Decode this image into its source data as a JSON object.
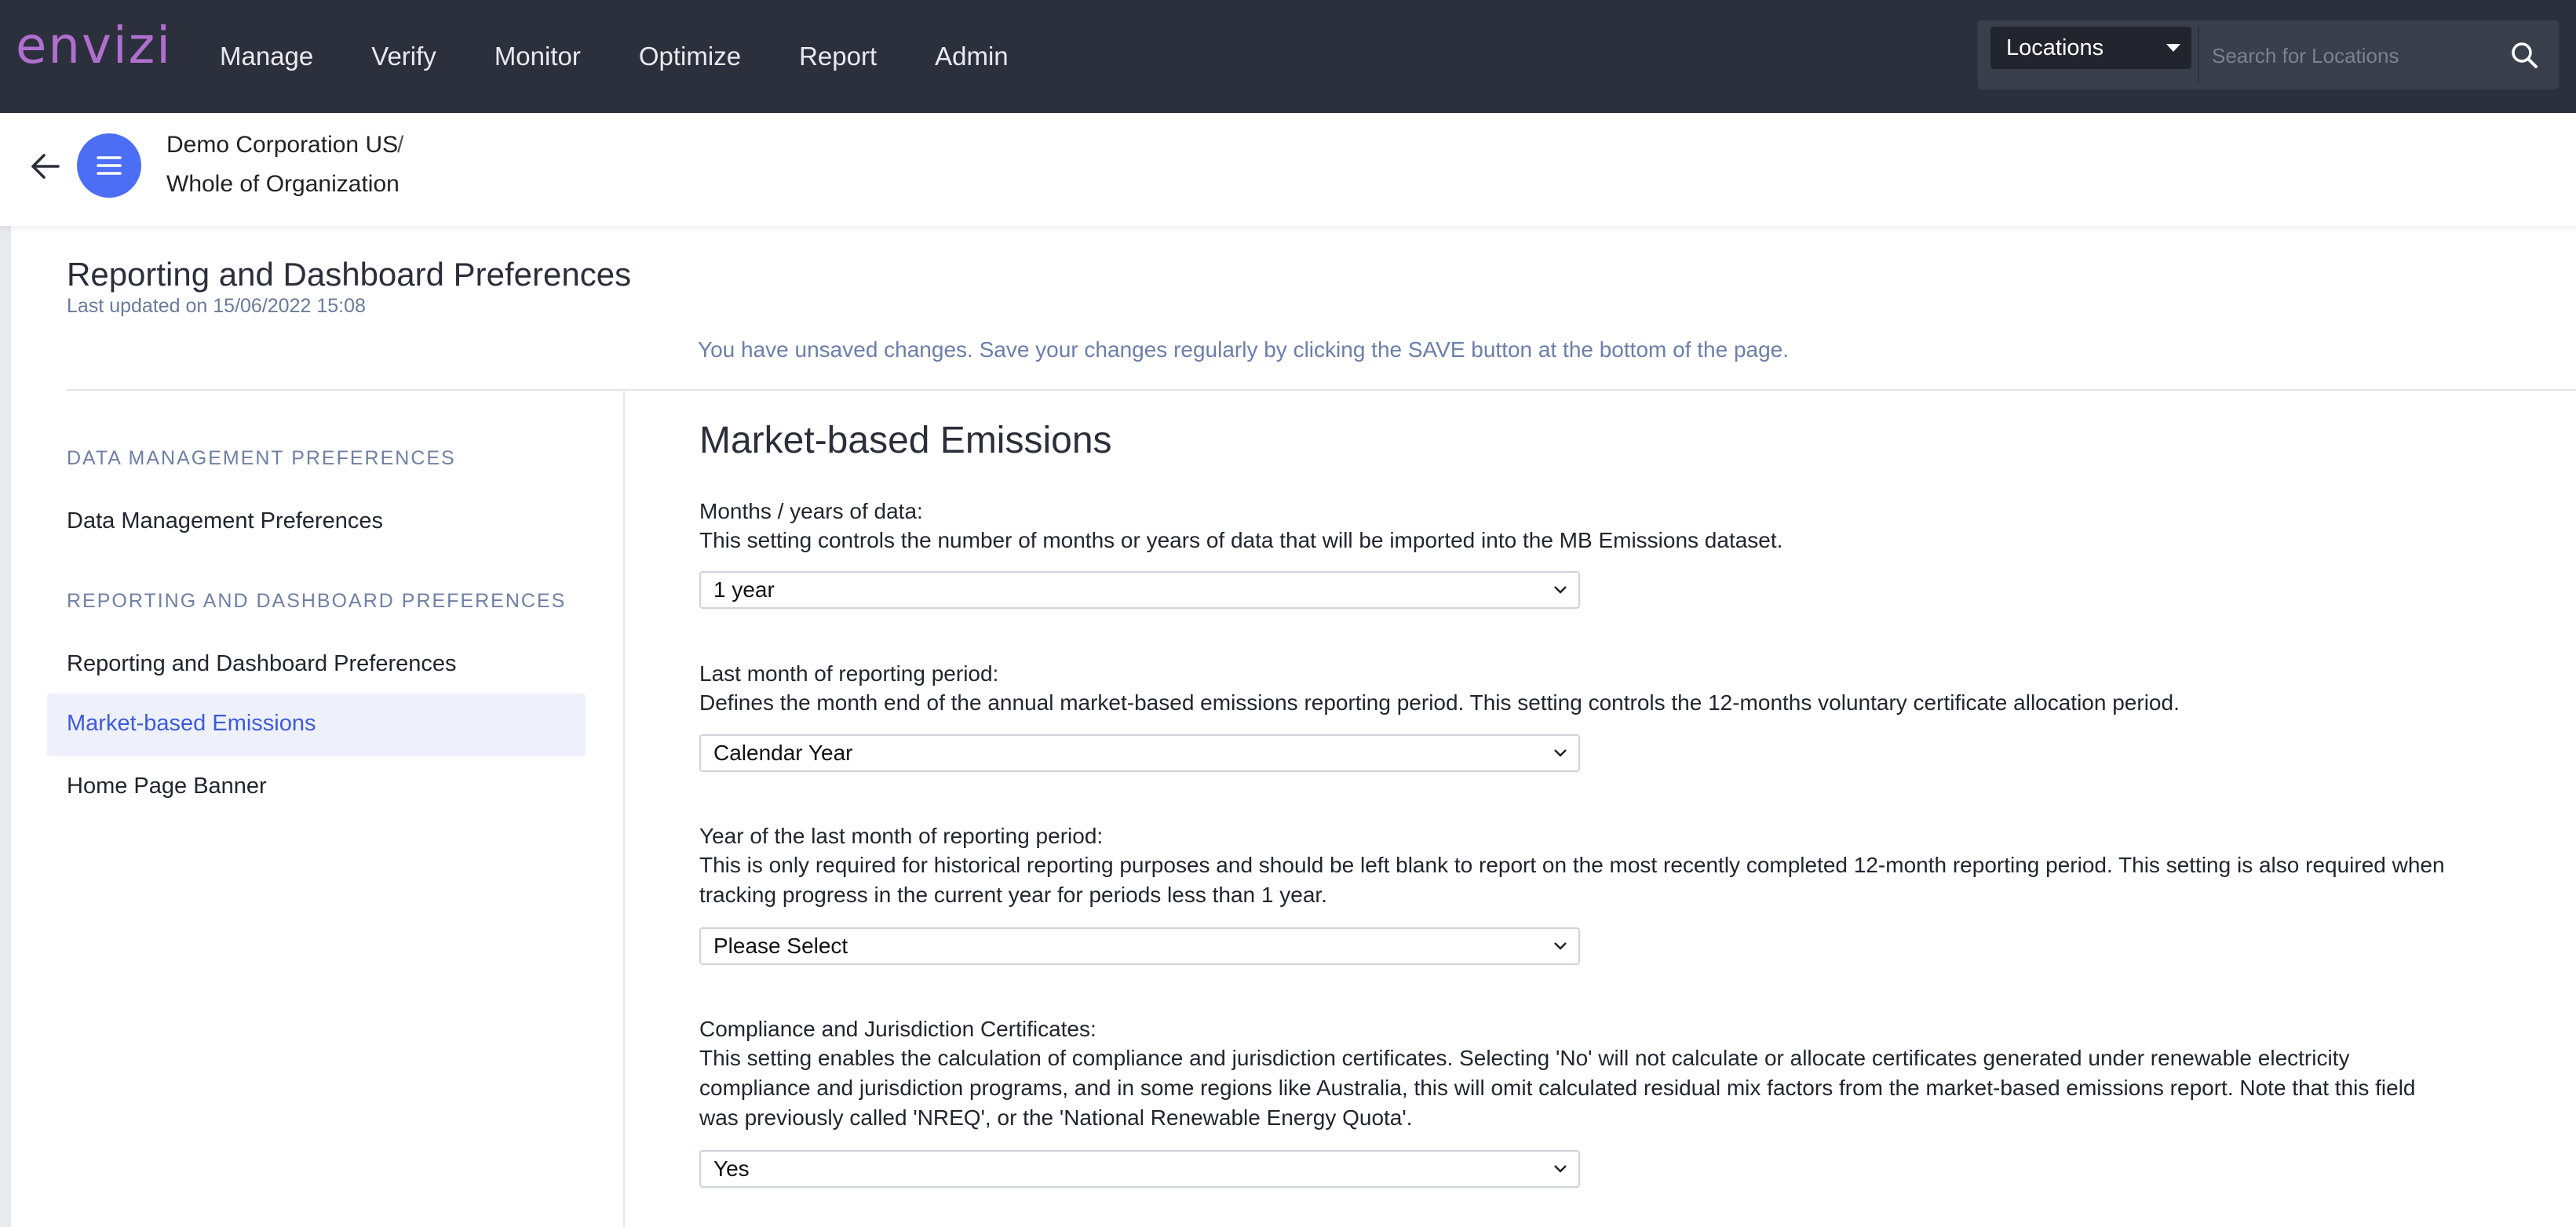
{
  "brand": {
    "logo_text": "envizi",
    "accent": "#b06fcf"
  },
  "nav": {
    "items": [
      "Manage",
      "Verify",
      "Monitor",
      "Optimize",
      "Report",
      "Admin"
    ]
  },
  "search": {
    "scope_label": "Locations",
    "placeholder": "Search for Locations"
  },
  "breadcrumb": {
    "parent": "Demo Corporation US",
    "separator": "/",
    "current": "Whole of Organization"
  },
  "page": {
    "title": "Reporting and Dashboard Preferences",
    "last_updated": "Last updated on 15/06/2022 15:08",
    "unsaved_notice": "You have unsaved changes. Save your changes regularly by clicking the SAVE button at the bottom of the page."
  },
  "sidebar": {
    "section1_heading": "DATA MANAGEMENT PREFERENCES",
    "section1_items": [
      "Data Management Preferences"
    ],
    "section2_heading": "REPORTING AND DASHBOARD PREFERENCES",
    "section2_items": [
      "Reporting and Dashboard Preferences",
      "Market-based Emissions",
      "Home Page Banner"
    ],
    "active_item": "Market-based Emissions"
  },
  "main": {
    "title": "Market-based Emissions",
    "fields": [
      {
        "label": "Months / years of data:",
        "description": "This setting controls the number of months or years of data that will be imported into the MB Emissions dataset.",
        "value": "1 year"
      },
      {
        "label": "Last month of reporting period:",
        "description": "Defines the month end of the annual market-based emissions reporting period. This setting controls the 12-months voluntary certificate allocation period.",
        "value": "Calendar Year"
      },
      {
        "label": "Year of the last month of reporting period:",
        "description": "This is only required for historical reporting purposes and should be left blank to report on the most recently completed 12-month reporting period. This setting is also required when tracking progress in the current year for periods less than 1 year.",
        "value": "Please Select"
      },
      {
        "label": "Compliance and Jurisdiction Certificates:",
        "description": "This setting enables the calculation of compliance and jurisdiction certificates. Selecting 'No' will not calculate or allocate certificates generated under renewable electricity compliance and jurisdiction programs, and in some regions like Australia, this will omit calculated residual mix factors from the market-based emissions report. Note that this field was previously called 'NREQ', or the 'National Renewable Energy Quota'.",
        "value": "Yes"
      }
    ]
  }
}
